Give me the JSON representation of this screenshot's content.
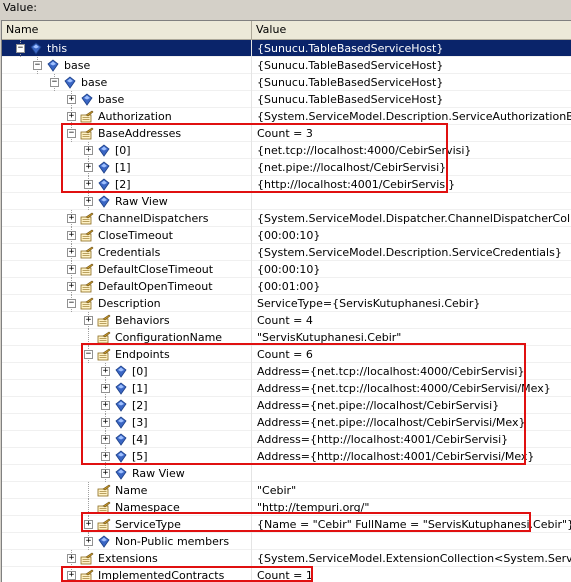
{
  "window": {
    "label": "Value:"
  },
  "columns": {
    "name": "Name",
    "value": "Value"
  },
  "rows": [
    {
      "name": "this",
      "value": "{Sunucu.TableBasedServiceHost}",
      "expander": "−",
      "icon": "field",
      "selected": true
    },
    {
      "name": "base",
      "value": "{Sunucu.TableBasedServiceHost}",
      "expander": "−",
      "icon": "field"
    },
    {
      "name": "base",
      "value": "{Sunucu.TableBasedServiceHost}",
      "expander": "−",
      "icon": "field"
    },
    {
      "name": "base",
      "value": "{Sunucu.TableBasedServiceHost}",
      "expander": "+",
      "icon": "field"
    },
    {
      "name": "Authorization",
      "value": "{System.ServiceModel.Description.ServiceAuthorizationBehavior}",
      "expander": "+",
      "icon": "property"
    },
    {
      "name": "BaseAddresses",
      "value": "Count = 3",
      "expander": "−",
      "icon": "property"
    },
    {
      "name": "[0]",
      "value": "{net.tcp://localhost:4000/CebirServisi}",
      "expander": "+",
      "icon": "field"
    },
    {
      "name": "[1]",
      "value": "{net.pipe://localhost/CebirServisi}",
      "expander": "+",
      "icon": "field"
    },
    {
      "name": "[2]",
      "value": "{http://localhost:4001/CebirServisi}",
      "expander": "+",
      "icon": "field"
    },
    {
      "name": "Raw View",
      "value": "",
      "expander": "+",
      "icon": "field"
    },
    {
      "name": "ChannelDispatchers",
      "value": "{System.ServiceModel.Dispatcher.ChannelDispatcherCollection}",
      "expander": "+",
      "icon": "property"
    },
    {
      "name": "CloseTimeout",
      "value": "{00:00:10}",
      "expander": "+",
      "icon": "property"
    },
    {
      "name": "Credentials",
      "value": "{System.ServiceModel.Description.ServiceCredentials}",
      "expander": "+",
      "icon": "property"
    },
    {
      "name": "DefaultCloseTimeout",
      "value": "{00:00:10}",
      "expander": "+",
      "icon": "property"
    },
    {
      "name": "DefaultOpenTimeout",
      "value": "{00:01:00}",
      "expander": "+",
      "icon": "property"
    },
    {
      "name": "Description",
      "value": "ServiceType={ServisKutuphanesi.Cebir}",
      "expander": "−",
      "icon": "property"
    },
    {
      "name": "Behaviors",
      "value": "Count = 4",
      "expander": "+",
      "icon": "property"
    },
    {
      "name": "ConfigurationName",
      "value": "\"ServisKutuphanesi.Cebir\"",
      "expander": "",
      "icon": "property"
    },
    {
      "name": "Endpoints",
      "value": "Count = 6",
      "expander": "−",
      "icon": "property"
    },
    {
      "name": "[0]",
      "value": "Address={net.tcp://localhost:4000/CebirServisi}",
      "expander": "+",
      "icon": "field"
    },
    {
      "name": "[1]",
      "value": "Address={net.tcp://localhost:4000/CebirServisi/Mex}",
      "expander": "+",
      "icon": "field"
    },
    {
      "name": "[2]",
      "value": "Address={net.pipe://localhost/CebirServisi}",
      "expander": "+",
      "icon": "field"
    },
    {
      "name": "[3]",
      "value": "Address={net.pipe://localhost/CebirServisi/Mex}",
      "expander": "+",
      "icon": "field"
    },
    {
      "name": "[4]",
      "value": "Address={http://localhost:4001/CebirServisi}",
      "expander": "+",
      "icon": "field"
    },
    {
      "name": "[5]",
      "value": "Address={http://localhost:4001/CebirServisi/Mex}",
      "expander": "+",
      "icon": "field"
    },
    {
      "name": "Raw View",
      "value": "",
      "expander": "+",
      "icon": "field"
    },
    {
      "name": "Name",
      "value": "\"Cebir\"",
      "expander": "",
      "icon": "property"
    },
    {
      "name": "Namespace",
      "value": "\"http://tempuri.org/\"",
      "expander": "",
      "icon": "property"
    },
    {
      "name": "ServiceType",
      "value": "{Name = \"Cebir\" FullName = \"ServisKutuphanesi.Cebir\"}",
      "expander": "+",
      "icon": "property"
    },
    {
      "name": "Non-Public members",
      "value": "",
      "expander": "+",
      "icon": "field"
    },
    {
      "name": "Extensions",
      "value": "{System.ServiceModel.ExtensionCollection<System.ServiceModel",
      "expander": "+",
      "icon": "property"
    },
    {
      "name": "ImplementedContracts",
      "value": "Count = 1",
      "expander": "+",
      "icon": "property"
    }
  ],
  "colors": {
    "selection": "#0a246a",
    "highlight": "#e01010",
    "field_icon": "#3a66c4",
    "property_icon": "#c89a2c"
  }
}
